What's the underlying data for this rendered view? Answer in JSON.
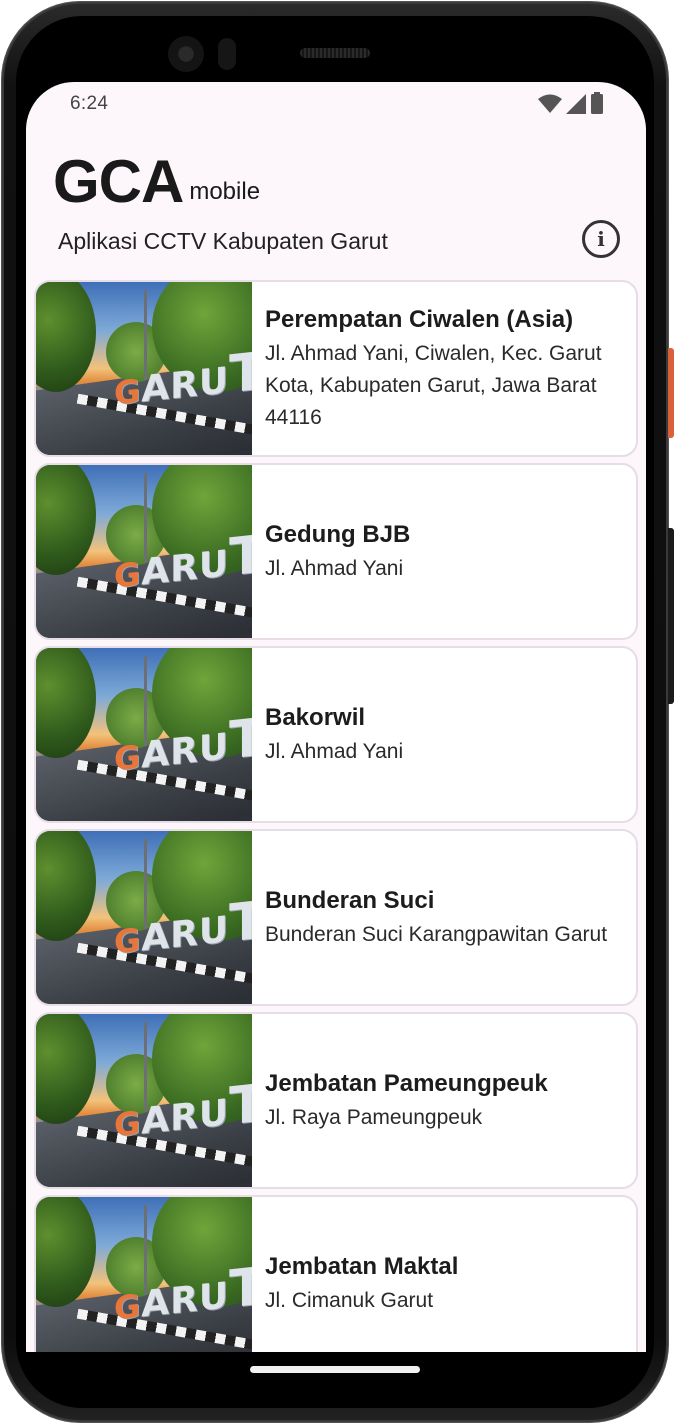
{
  "status_bar": {
    "time": "6:24",
    "icons": [
      "wifi-icon",
      "signal-icon",
      "battery-icon"
    ]
  },
  "header": {
    "logo_main": "GCA",
    "logo_sub": "mobile",
    "subtitle": "Aplikasi CCTV Kabupaten Garut",
    "info_icon": "info-icon"
  },
  "locations": [
    {
      "name": "Perempatan Ciwalen (Asia)",
      "address": "Jl. Ahmad Yani, Ciwalen, Kec. Garut Kota, Kabupaten Garut, Jawa Barat 44116"
    },
    {
      "name": "Gedung BJB",
      "address": "Jl. Ahmad Yani"
    },
    {
      "name": "Bakorwil",
      "address": "Jl. Ahmad Yani"
    },
    {
      "name": "Bunderan Suci",
      "address": "Bunderan Suci Karangpawitan Garut"
    },
    {
      "name": "Jembatan Pameungpeuk",
      "address": "Jl. Raya Pameungpeuk"
    },
    {
      "name": "Jembatan Maktal",
      "address": "Jl. Cimanuk Garut"
    }
  ],
  "thumbnail_letters": [
    "G",
    "A",
    "R",
    "U",
    "T"
  ],
  "colors": {
    "screen_bg": "#fdf7fb",
    "card_border": "#e6dde6",
    "accent_letter": "#e8763a",
    "power_button": "#d9613a"
  }
}
